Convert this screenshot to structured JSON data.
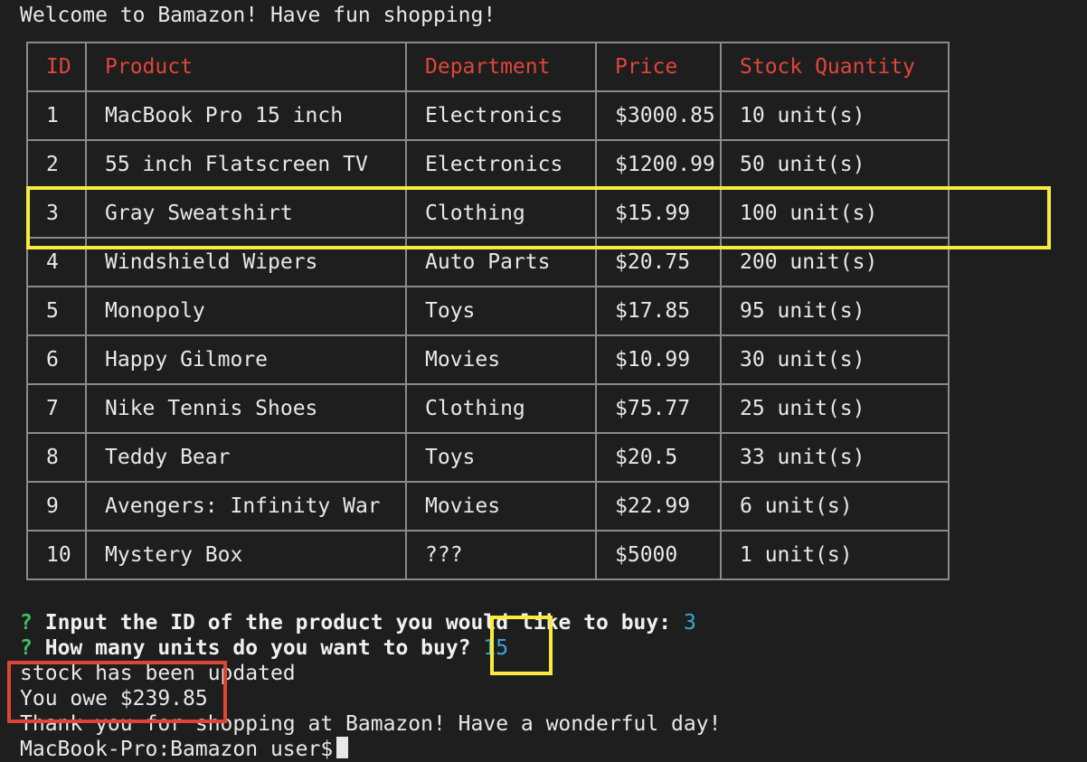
{
  "terminal": {
    "welcome": "Welcome to Bamazon! Have fun shopping!",
    "table": {
      "headers": [
        "ID",
        "Product",
        "Department",
        "Price",
        "Stock Quantity"
      ],
      "rows": [
        {
          "id": "1",
          "product": "MacBook Pro 15 inch",
          "department": "Electronics",
          "price": "$3000.85",
          "stock": "10 unit(s)"
        },
        {
          "id": "2",
          "product": "55 inch Flatscreen TV",
          "department": "Electronics",
          "price": "$1200.99",
          "stock": "50 unit(s)"
        },
        {
          "id": "3",
          "product": "Gray Sweatshirt",
          "department": "Clothing",
          "price": "$15.99",
          "stock": "100 unit(s)"
        },
        {
          "id": "4",
          "product": "Windshield Wipers",
          "department": "Auto Parts",
          "price": "$20.75",
          "stock": "200 unit(s)"
        },
        {
          "id": "5",
          "product": "Monopoly",
          "department": "Toys",
          "price": "$17.85",
          "stock": "95 unit(s)"
        },
        {
          "id": "6",
          "product": "Happy Gilmore",
          "department": "Movies",
          "price": "$10.99",
          "stock": "30 unit(s)"
        },
        {
          "id": "7",
          "product": "Nike Tennis Shoes",
          "department": "Clothing",
          "price": "$75.77",
          "stock": "25 unit(s)"
        },
        {
          "id": "8",
          "product": "Teddy Bear",
          "department": "Toys",
          "price": "$20.5",
          "stock": "33 unit(s)"
        },
        {
          "id": "9",
          "product": "Avengers: Infinity War",
          "department": "Movies",
          "price": "$22.99",
          "stock": "6 unit(s)"
        },
        {
          "id": "10",
          "product": "Mystery Box",
          "department": "???",
          "price": "$5000",
          "stock": "1 unit(s)"
        }
      ]
    },
    "prompts": [
      {
        "mark": "?",
        "question": "Input the ID of the product you would like to buy:",
        "answer": "3"
      },
      {
        "mark": "?",
        "question": "How many units do you want to buy?",
        "answer": "15"
      }
    ],
    "output": {
      "stock_updated": "stock has been updated",
      "total": "You owe $239.85",
      "thanks": "Thank you for shopping at Bamazon! Have a wonderful day!",
      "shell_prompt": "MacBook-Pro:Bamazon user$"
    },
    "colors": {
      "background": "#1e1e1e",
      "header_text": "#e0463a",
      "prompt_mark": "#3fbf5f",
      "answer_text": "#3aa8d8",
      "highlight_yellow": "#f7ec3c",
      "highlight_red": "#e04434"
    }
  }
}
